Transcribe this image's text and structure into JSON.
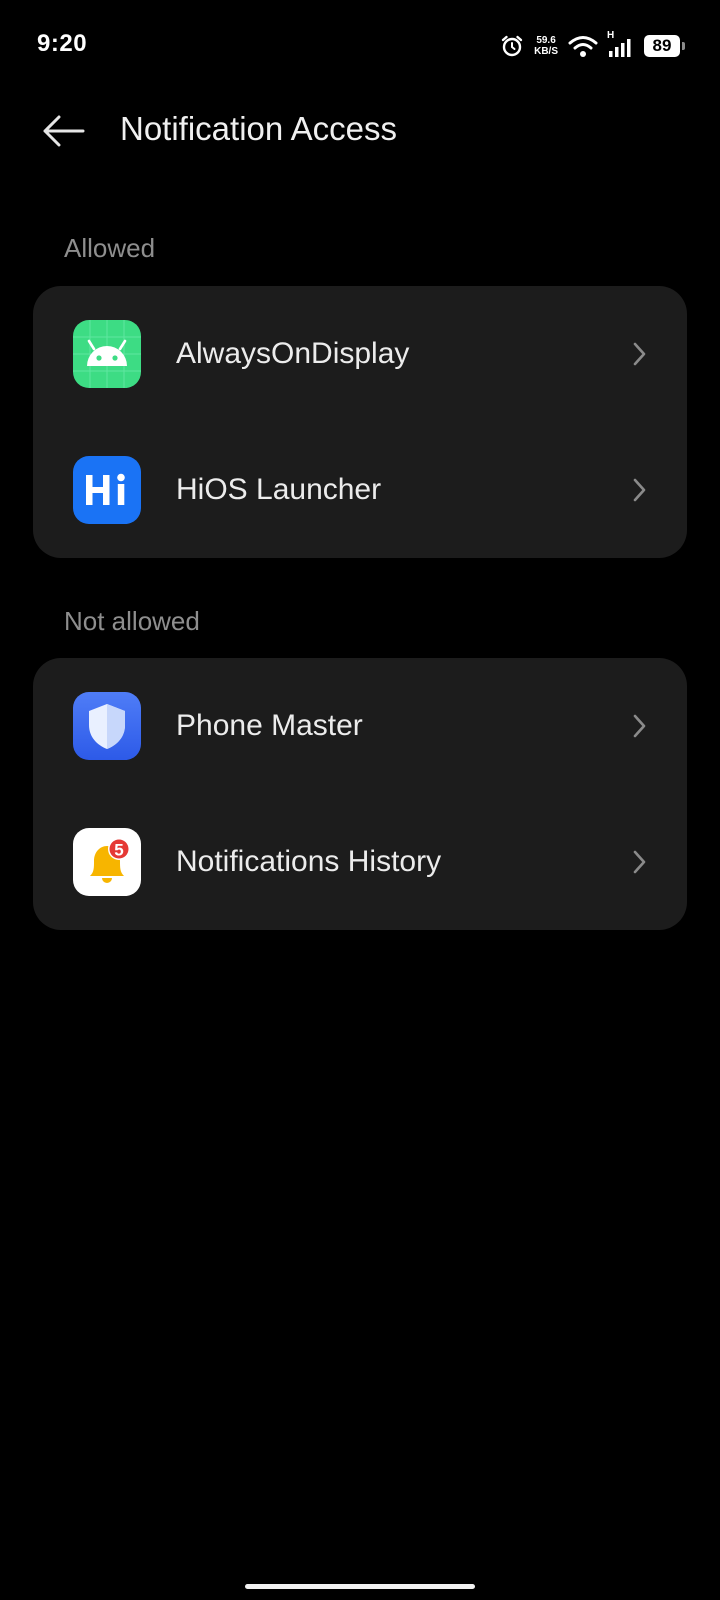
{
  "status_bar": {
    "time": "9:20",
    "net_speed_value": "59.6",
    "net_speed_unit": "KB/S",
    "network_type": "H",
    "battery_level": "89"
  },
  "header": {
    "title": "Notification Access"
  },
  "sections": [
    {
      "label": "Allowed",
      "items": [
        {
          "label": "AlwaysOnDisplay",
          "icon": "android-icon"
        },
        {
          "label": "HiOS Launcher",
          "icon": "hios-launcher-icon",
          "icon_text": "Hi"
        }
      ]
    },
    {
      "label": "Not allowed",
      "items": [
        {
          "label": "Phone Master",
          "icon": "phone-master-shield-icon"
        },
        {
          "label": "Notifications History",
          "icon": "notification-bell-icon",
          "badge_count": "5"
        }
      ]
    }
  ],
  "colors": {
    "background": "#000000",
    "card": "#1c1c1c",
    "section_label": "#8e8e8e",
    "android_green": "#3ddc84",
    "hios_blue": "#1a73f5",
    "phone_master_blue": "#3d6cf2",
    "bell_yellow": "#f7b500",
    "badge_red": "#e53935"
  }
}
